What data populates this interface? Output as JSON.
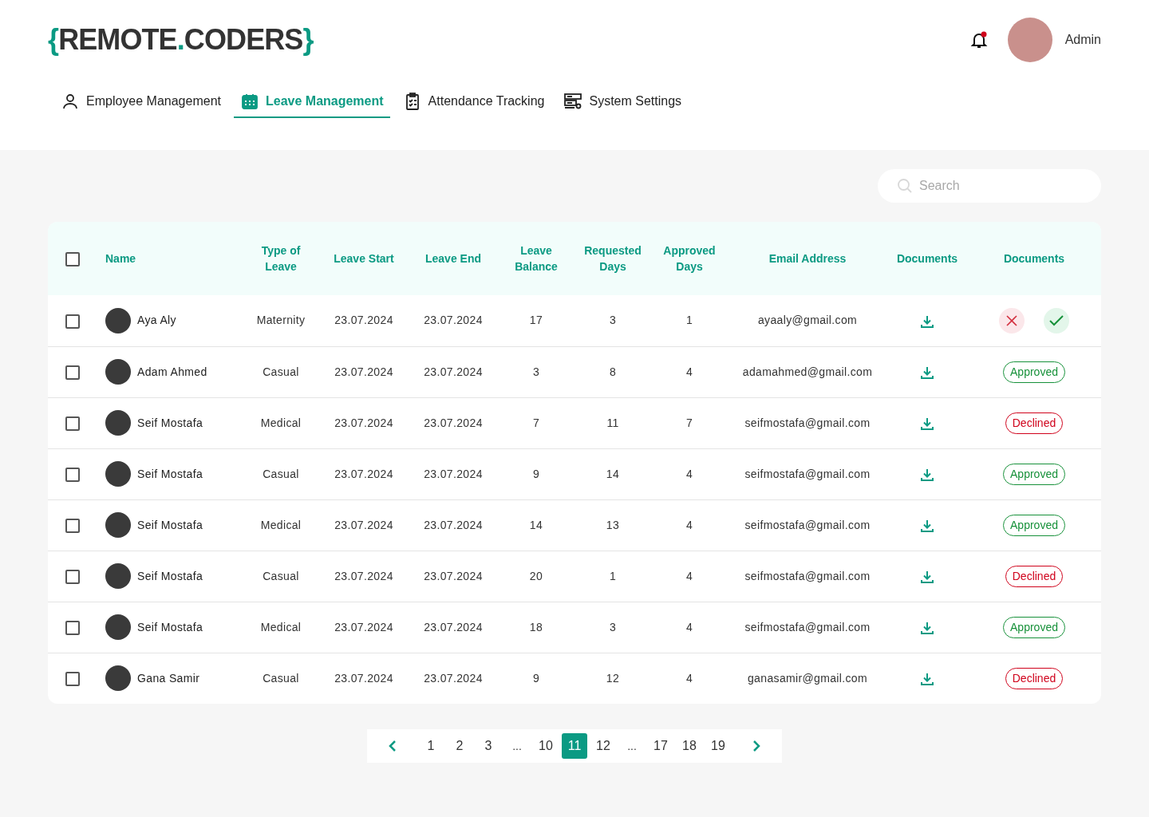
{
  "logo": [
    {
      "text": "{",
      "accent": true
    },
    {
      "text": "REMOTE",
      "accent": false
    },
    {
      "text": ".",
      "accent": true
    },
    {
      "text": "CODERS",
      "accent": false
    },
    {
      "text": "}",
      "accent": true
    }
  ],
  "header": {
    "notification": true,
    "user": "Admin"
  },
  "tabs": [
    {
      "label": "Employee Management",
      "selected": false
    },
    {
      "label": "Leave Management",
      "selected": true
    },
    {
      "label": "Attendance Tracking",
      "selected": false
    },
    {
      "label": "System Settings",
      "selected": false
    }
  ],
  "search": {
    "placeholder": "Search"
  },
  "table": {
    "select_all": false,
    "columns": [
      "Name",
      "Type of Leave",
      "Leave Start",
      "Leave End",
      "Leave Balance",
      "Requested Days",
      "Approved Days",
      "Email Address",
      "Documents",
      "Documents"
    ],
    "rows": [
      {
        "checked": false,
        "name": "Aya Aly",
        "type": "Maternity",
        "start": "23.07.2024",
        "end": "23.07.2024",
        "balance": "17",
        "requested": "3",
        "approved": "1",
        "email": "ayaaly@gmail.com",
        "status": {
          "kind": "pending"
        }
      },
      {
        "checked": false,
        "name": "Adam Ahmed",
        "type": "Casual",
        "start": "23.07.2024",
        "end": "23.07.2024",
        "balance": "3",
        "requested": "8",
        "approved": "4",
        "email": "adamahmed@gmail.com",
        "status": {
          "kind": "approved",
          "label": "Approved"
        }
      },
      {
        "checked": false,
        "name": "Seif Mostafa",
        "type": "Medical",
        "start": "23.07.2024",
        "end": "23.07.2024",
        "balance": "7",
        "requested": "11",
        "approved": "7",
        "email": "seifmostafa@gmail.com",
        "status": {
          "kind": "declined",
          "label": "Declined"
        }
      },
      {
        "checked": false,
        "name": "Seif Mostafa",
        "type": "Casual",
        "start": "23.07.2024",
        "end": "23.07.2024",
        "balance": "9",
        "requested": "14",
        "approved": "4",
        "email": "seifmostafa@gmail.com",
        "status": {
          "kind": "approved",
          "label": "Approved"
        }
      },
      {
        "checked": false,
        "name": "Seif Mostafa",
        "type": "Medical",
        "start": "23.07.2024",
        "end": "23.07.2024",
        "balance": "14",
        "requested": "13",
        "approved": "4",
        "email": "seifmostafa@gmail.com",
        "status": {
          "kind": "approved",
          "label": "Approved"
        }
      },
      {
        "checked": false,
        "name": "Seif Mostafa",
        "type": "Casual",
        "start": "23.07.2024",
        "end": "23.07.2024",
        "balance": "20",
        "requested": "1",
        "approved": "4",
        "email": "seifmostafa@gmail.com",
        "status": {
          "kind": "declined",
          "label": "Declined"
        }
      },
      {
        "checked": false,
        "name": "Seif Mostafa",
        "type": "Medical",
        "start": "23.07.2024",
        "end": "23.07.2024",
        "balance": "18",
        "requested": "3",
        "approved": "4",
        "email": "seifmostafa@gmail.com",
        "status": {
          "kind": "approved",
          "label": "Approved"
        }
      },
      {
        "checked": false,
        "name": "Gana Samir",
        "type": "Casual",
        "start": "23.07.2024",
        "end": "23.07.2024",
        "balance": "9",
        "requested": "12",
        "approved": "4",
        "email": "ganasamir@gmail.com",
        "status": {
          "kind": "declined",
          "label": "Declined"
        }
      }
    ]
  },
  "pagination": [
    {
      "kind": "page",
      "label": "1",
      "selected": false
    },
    {
      "kind": "page",
      "label": "2",
      "selected": false
    },
    {
      "kind": "page",
      "label": "3",
      "selected": false
    },
    {
      "kind": "gap",
      "label": "..."
    },
    {
      "kind": "page",
      "label": "10",
      "selected": false
    },
    {
      "kind": "page",
      "label": "11",
      "selected": true
    },
    {
      "kind": "page",
      "label": "12",
      "selected": false
    },
    {
      "kind": "gap",
      "label": "..."
    },
    {
      "kind": "page",
      "label": "17",
      "selected": false
    },
    {
      "kind": "page",
      "label": "18",
      "selected": false
    },
    {
      "kind": "page",
      "label": "19",
      "selected": false
    }
  ]
}
